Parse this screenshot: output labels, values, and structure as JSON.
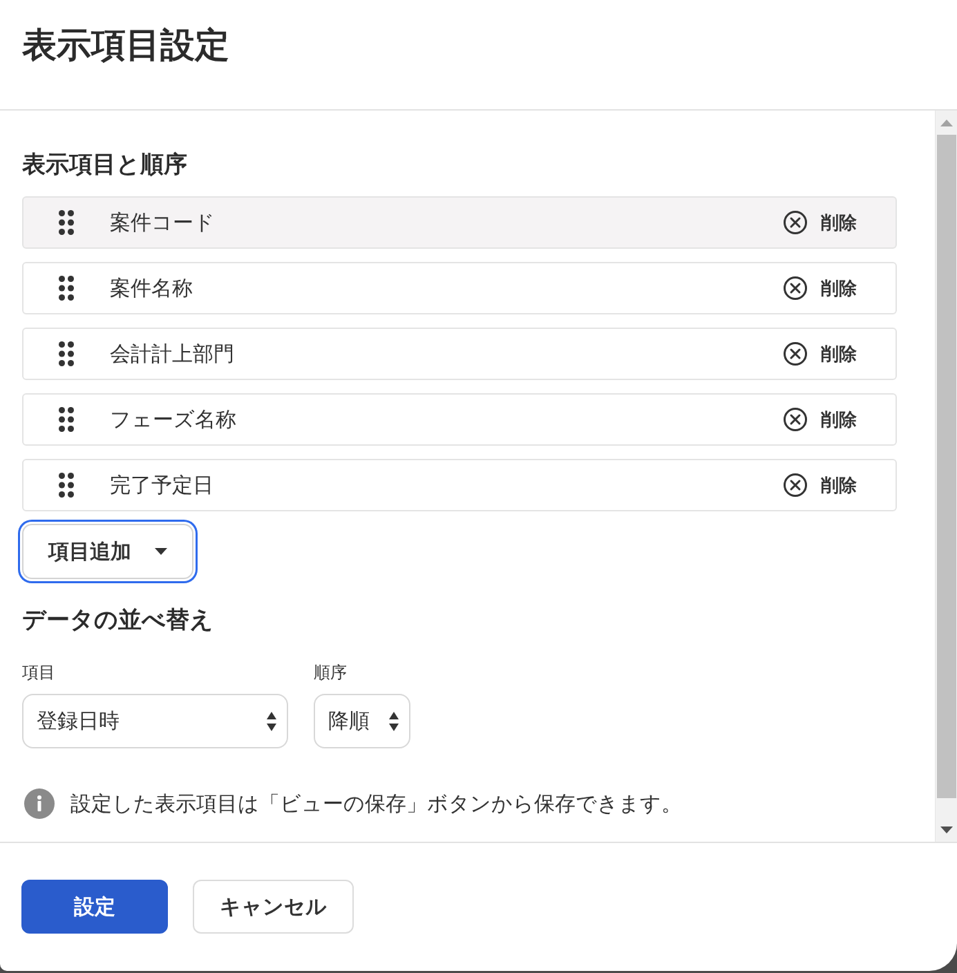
{
  "dialog": {
    "title": "表示項目設定"
  },
  "columns_section": {
    "heading": "表示項目と順序",
    "items": [
      {
        "label": "案件コード",
        "selected": true,
        "action": "削除"
      },
      {
        "label": "案件名称",
        "selected": false,
        "action": "削除"
      },
      {
        "label": "会計計上部門",
        "selected": false,
        "action": "削除"
      },
      {
        "label": "フェーズ名称",
        "selected": false,
        "action": "削除"
      },
      {
        "label": "完了予定日",
        "selected": false,
        "action": "削除"
      }
    ],
    "add_button": {
      "label": "項目追加",
      "focused": true
    }
  },
  "sort_section": {
    "heading": "データの並べ替え",
    "fields": [
      {
        "label": "項目",
        "value": "登録日時"
      },
      {
        "label": "順序",
        "value": "降順"
      }
    ]
  },
  "note": "設定した表示項目は「ビューの保存」ボタンから保存できます。",
  "footer": {
    "buttons": [
      {
        "label": "設定",
        "kind": "primary"
      },
      {
        "label": "キャンセル",
        "kind": "secondary"
      }
    ]
  }
}
